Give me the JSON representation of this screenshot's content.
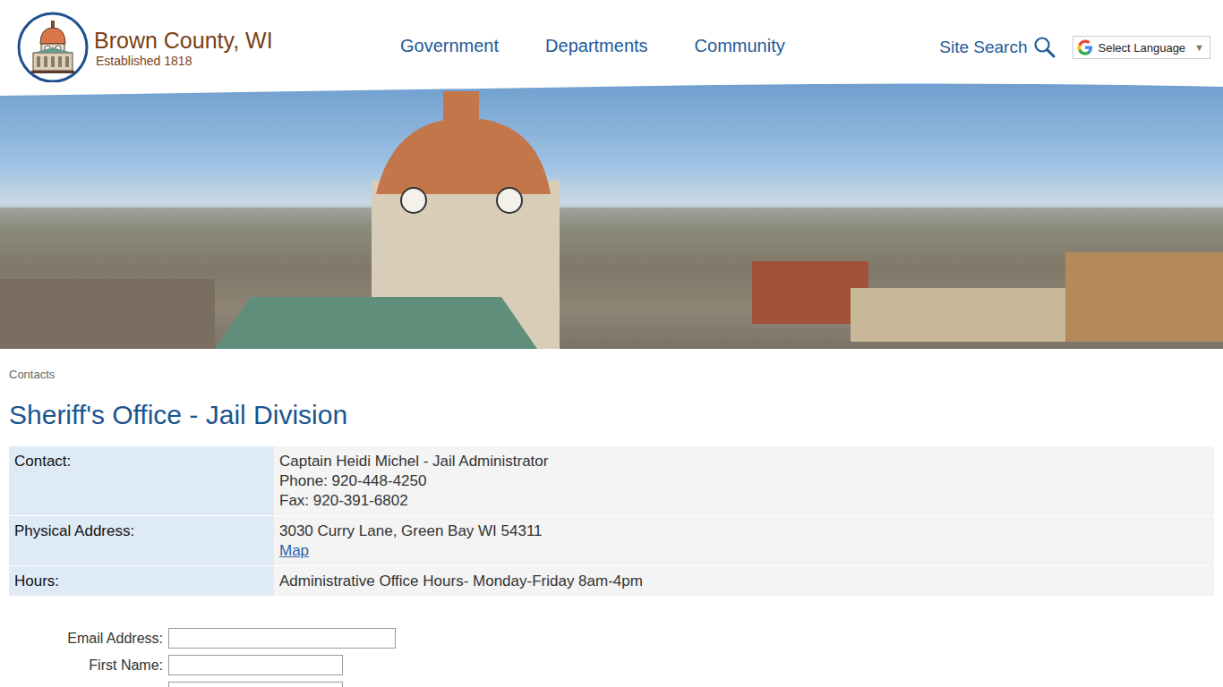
{
  "site": {
    "title": "Brown County, WI",
    "subtitle": "Established 1818"
  },
  "nav": [
    {
      "label": "Government"
    },
    {
      "label": "Departments"
    },
    {
      "label": "Community"
    }
  ],
  "search": {
    "label": "Site Search"
  },
  "language": {
    "label": "Select Language",
    "arrow": "▼"
  },
  "breadcrumb": "Contacts",
  "page_title": "Sheriff's Office - Jail Division",
  "details": [
    {
      "label": "Contact:",
      "lines": [
        "Captain Heidi Michel - Jail Administrator",
        "Phone: 920-448-4250",
        "Fax: 920-391-6802"
      ]
    },
    {
      "label": "Physical Address:",
      "lines": [
        "3030 Curry Lane, Green Bay WI 54311"
      ],
      "link": "Map"
    },
    {
      "label": "Hours:",
      "lines": [
        "Administrative Office Hours- Monday-Friday 8am-4pm"
      ]
    }
  ],
  "form": {
    "fields": [
      {
        "label": "Email Address:",
        "value": ""
      },
      {
        "label": "First Name:",
        "value": ""
      },
      {
        "value": ""
      }
    ]
  }
}
